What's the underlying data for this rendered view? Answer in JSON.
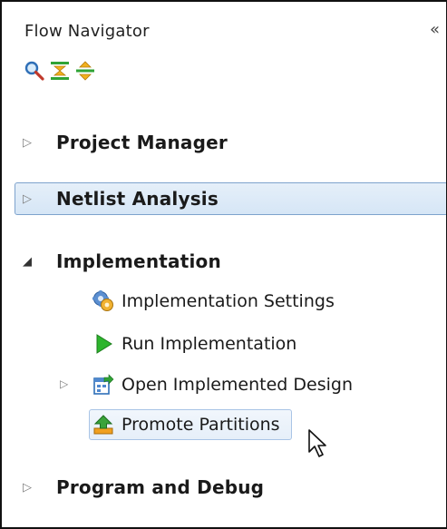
{
  "panel": {
    "title": "Flow Navigator",
    "collapse_glyph": "«"
  },
  "toolbar": {
    "icons": [
      "search-icon",
      "collapse-all-icon",
      "expand-all-icon"
    ]
  },
  "sections": {
    "project_manager": {
      "label": "Project Manager",
      "expanded": false
    },
    "netlist_analysis": {
      "label": "Netlist Analysis",
      "expanded": false,
      "selected": true
    },
    "implementation": {
      "label": "Implementation",
      "expanded": true,
      "items": {
        "settings": {
          "label": "Implementation Settings",
          "icon": "gear-settings-icon"
        },
        "run": {
          "label": "Run Implementation",
          "icon": "play-icon"
        },
        "open_design": {
          "label": "Open Implemented Design",
          "icon": "open-design-icon",
          "expandable": true
        },
        "promote": {
          "label": "Promote Partitions",
          "icon": "promote-partitions-icon",
          "hovered": true
        }
      }
    },
    "program_debug": {
      "label": "Program and Debug",
      "expanded": false
    }
  },
  "colors": {
    "selection_fill": "#dbe8f6",
    "selection_border": "#7ea3cd",
    "play_green": "#2db52d",
    "promote_green": "#3aa33a",
    "promote_orange": "#f0a020"
  }
}
